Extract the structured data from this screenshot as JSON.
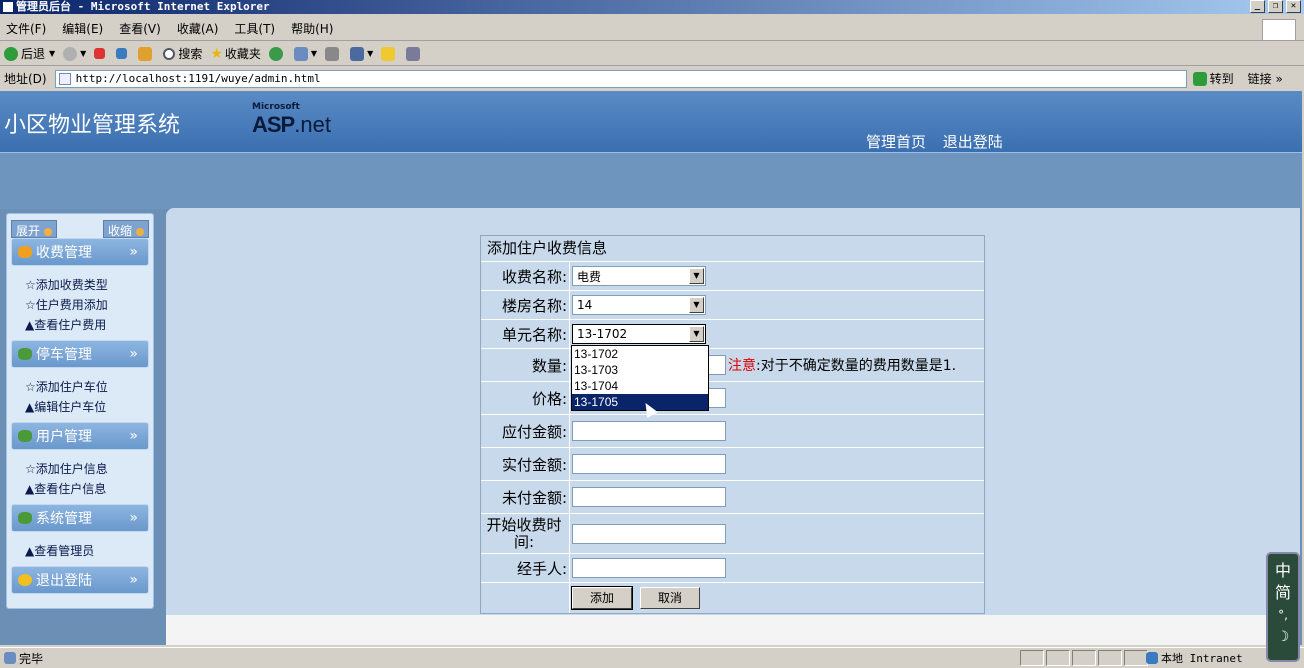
{
  "window": {
    "title": "管理员后台 - Microsoft Internet Explorer"
  },
  "menu": [
    "文件(F)",
    "编辑(E)",
    "查看(V)",
    "收藏(A)",
    "工具(T)",
    "帮助(H)"
  ],
  "toolbar": {
    "back": "后退",
    "search": "搜索",
    "favorites": "收藏夹"
  },
  "address": {
    "label": "地址(D)",
    "url": "http://localhost:1191/wuye/admin.html",
    "go": "转到",
    "links": "链接"
  },
  "header": {
    "title": "小区物业管理系统",
    "logo_ms": "Microsoft",
    "logo_asp": "ASP",
    "logo_net": ".net",
    "nav_home": "管理首页",
    "nav_logout": "退出登陆"
  },
  "sidebar": {
    "expand": "展开",
    "collapse": "收缩",
    "sections": [
      {
        "title": "收费管理",
        "items": [
          "☆添加收费类型",
          "☆住户费用添加",
          "▲查看住户费用"
        ]
      },
      {
        "title": "停车管理",
        "items": [
          "☆添加住户车位",
          "▲编辑住户车位"
        ]
      },
      {
        "title": "用户管理",
        "items": [
          "☆添加住户信息",
          "▲查看住户信息"
        ]
      },
      {
        "title": "系统管理",
        "items": [
          "▲查看管理员"
        ]
      },
      {
        "title": "退出登陆",
        "items": []
      }
    ]
  },
  "form": {
    "caption": "添加住户收费信息",
    "fee_name_label": "收费名称:",
    "fee_name_value": "电费",
    "building_label": "楼房名称:",
    "building_value": "14",
    "unit_label": "单元名称:",
    "unit_value": "13-1702",
    "quantity_label": "数量:",
    "note_prefix": "注意",
    "note_text": ":对于不确定数量的费用数量是1.",
    "price_label": "价格:",
    "payable_label": "应付金额:",
    "paid_label": "实付金额:",
    "unpaid_label": "未付金额:",
    "start_label": "开始收费时间:",
    "handler_label": "经手人:",
    "add_button": "添加",
    "cancel_button": "取消"
  },
  "unit_dropdown": {
    "options": [
      "13-1702",
      "13-1703",
      "13-1704",
      "13-1705"
    ],
    "highlighted": "13-1705"
  },
  "status": {
    "text": "完毕",
    "zone": "本地 Intranet"
  },
  "ime": {
    "line1": "中",
    "line2": "简"
  }
}
